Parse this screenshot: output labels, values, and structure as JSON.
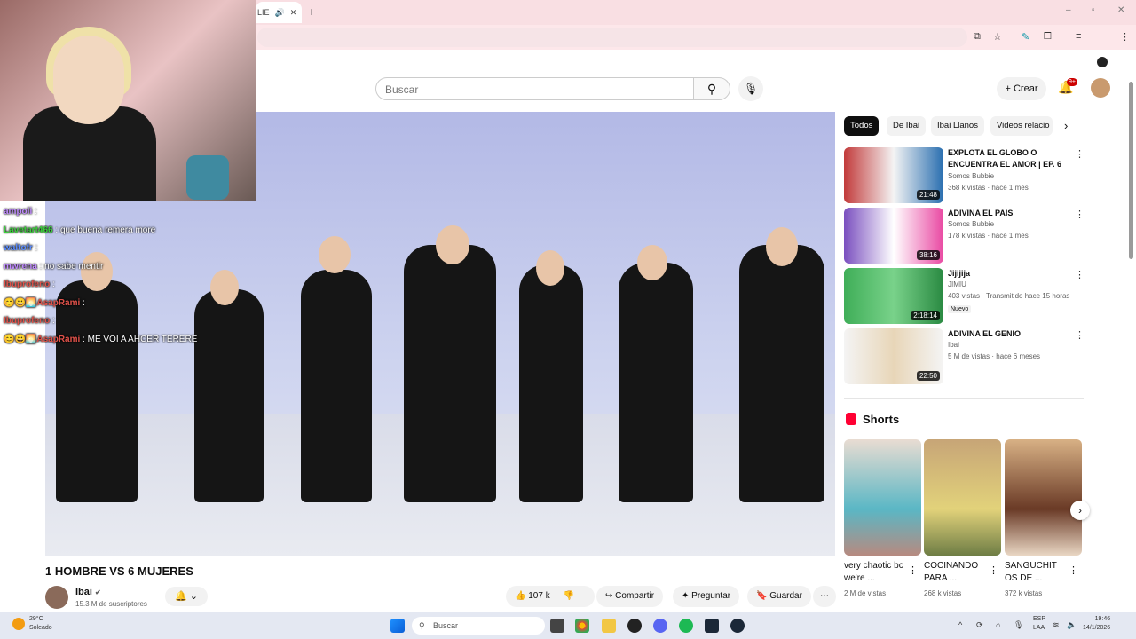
{
  "browser": {
    "tab_title": "LIE",
    "win_minimize": "–",
    "win_maximize": "▫",
    "win_close": "✕"
  },
  "youtube": {
    "search_placeholder": "Buscar",
    "create_label": "Crear",
    "notifications_badge": "9+"
  },
  "chat": [
    {
      "user": "ampoli",
      "color": "#c18cff",
      "msg": "",
      "icons": ""
    },
    {
      "user": "Lavetart466",
      "color": "#3cd23c",
      "msg": "que buena remera more",
      "icons": ""
    },
    {
      "user": "waltofr",
      "color": "#5a8cff",
      "msg": "",
      "icons": ""
    },
    {
      "user": "mwrena",
      "color": "#c18cff",
      "msg": "no sabe mentir",
      "icons": ""
    },
    {
      "user": "Ibuprofeno",
      "color": "#e0524a",
      "msg": "",
      "icons": ""
    },
    {
      "user": "AsapRami",
      "color": "#e0524a",
      "msg": "",
      "icons": "😊😀🌅"
    },
    {
      "user": "Ibuprofeno",
      "color": "#e0524a",
      "msg": "",
      "icons": ""
    },
    {
      "user": "AsapRami",
      "color": "#e0524a",
      "msg": "ME VOI A AHCER TERERE",
      "icons": "😊😀🌅"
    }
  ],
  "video": {
    "title": "1 HOMBRE VS 6 MUJERES",
    "channel": "Ibai",
    "subscribers": "15.3 M de suscriptores",
    "likes": "107 k",
    "share_label": "Compartir",
    "ask_label": "Preguntar",
    "save_label": "Guardar"
  },
  "chips": [
    "Todos",
    "De Ibai",
    "Ibai Llanos",
    "Videos relacio"
  ],
  "recommendations": [
    {
      "title": "EXPLOTA EL GLOBO O ENCUENTRA EL AMOR | EP. 6",
      "channel": "Somos Bubbie",
      "meta": "368 k vistas · hace 1 mes",
      "duration": "21:48",
      "badge": ""
    },
    {
      "title": "ADIVINA EL PAIS",
      "channel": "Somos Bubbie",
      "meta": "178 k vistas · hace 1 mes",
      "duration": "38:16",
      "badge": ""
    },
    {
      "title": "Jijijija",
      "channel": "JIMIU",
      "meta": "403 vistas · Transmitido hace 15 horas",
      "duration": "2:18:14",
      "badge": "Nuevo"
    },
    {
      "title": "ADIVINA EL GENIO",
      "channel": "Ibai",
      "meta": "5 M de vistas · hace 6 meses",
      "duration": "22:50",
      "badge": ""
    }
  ],
  "shorts": {
    "heading": "Shorts",
    "items": [
      {
        "title": "very chaotic bc we're ...",
        "views": "2 M de vistas"
      },
      {
        "title": "COCINANDO PARA ...",
        "views": "268 k vistas"
      },
      {
        "title": "SANGUCHIT OS DE ...",
        "views": "372 k vistas"
      }
    ]
  },
  "taskbar": {
    "weather_temp": "29°C",
    "weather_desc": "Soleado",
    "search_label": "Buscar",
    "lang": "ESP",
    "lang2": "LAA",
    "time": "19:46",
    "date": "14/1/2026"
  }
}
